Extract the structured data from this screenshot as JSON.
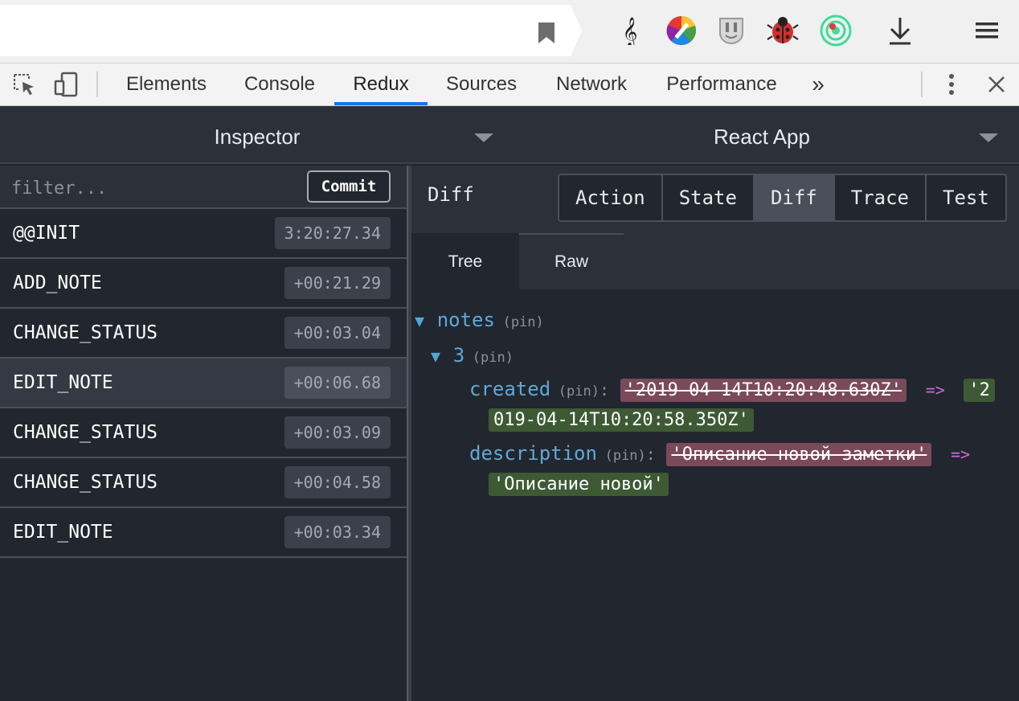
{
  "browser": {
    "extensions": [
      "music-icon",
      "color-picker-icon",
      "mask-icon",
      "bug-icon",
      "target-icon",
      "download-icon"
    ]
  },
  "devtools": {
    "tabs": [
      "Elements",
      "Console",
      "Redux",
      "Sources",
      "Network",
      "Performance"
    ],
    "more": "»",
    "active_tab": "Redux",
    "accent": "#1a73e8"
  },
  "monitor": {
    "left_select": "Inspector",
    "right_select": "React App"
  },
  "actions": {
    "filter_placeholder": "filter...",
    "commit_label": "Commit",
    "items": [
      {
        "name": "@@INIT",
        "time": "3:20:27.34"
      },
      {
        "name": "ADD_NOTE",
        "time": "+00:21.29"
      },
      {
        "name": "CHANGE_STATUS",
        "time": "+00:03.04"
      },
      {
        "name": "EDIT_NOTE",
        "time": "+00:06.68"
      },
      {
        "name": "CHANGE_STATUS",
        "time": "+00:03.09"
      },
      {
        "name": "CHANGE_STATUS",
        "time": "+00:04.58"
      },
      {
        "name": "EDIT_NOTE",
        "time": "+00:03.34"
      }
    ],
    "selected_index": 3
  },
  "inspector": {
    "title": "Diff",
    "tabs": [
      "Action",
      "State",
      "Diff",
      "Trace",
      "Test"
    ],
    "active_tab": "Diff",
    "subtabs": [
      "Tree",
      "Raw"
    ],
    "active_subtab": "Tree"
  },
  "diff": {
    "root_key": "notes",
    "child_key": "3",
    "pin": "(pin)",
    "arrow": "=>",
    "created_key": "created",
    "created_old": "'2019-04-14T10:20:48.630Z'",
    "created_new_line1": "'2",
    "created_new_line2": "019-04-14T10:20:58.350Z'",
    "description_key": "description",
    "description_old": "'Описание новой заметки'",
    "description_new": "'Описание новой'",
    "colors": {
      "added": "#3d5a34",
      "removed": "#7a4a5a",
      "key": "#5fa9d6",
      "arrow": "#c86bd0"
    }
  }
}
